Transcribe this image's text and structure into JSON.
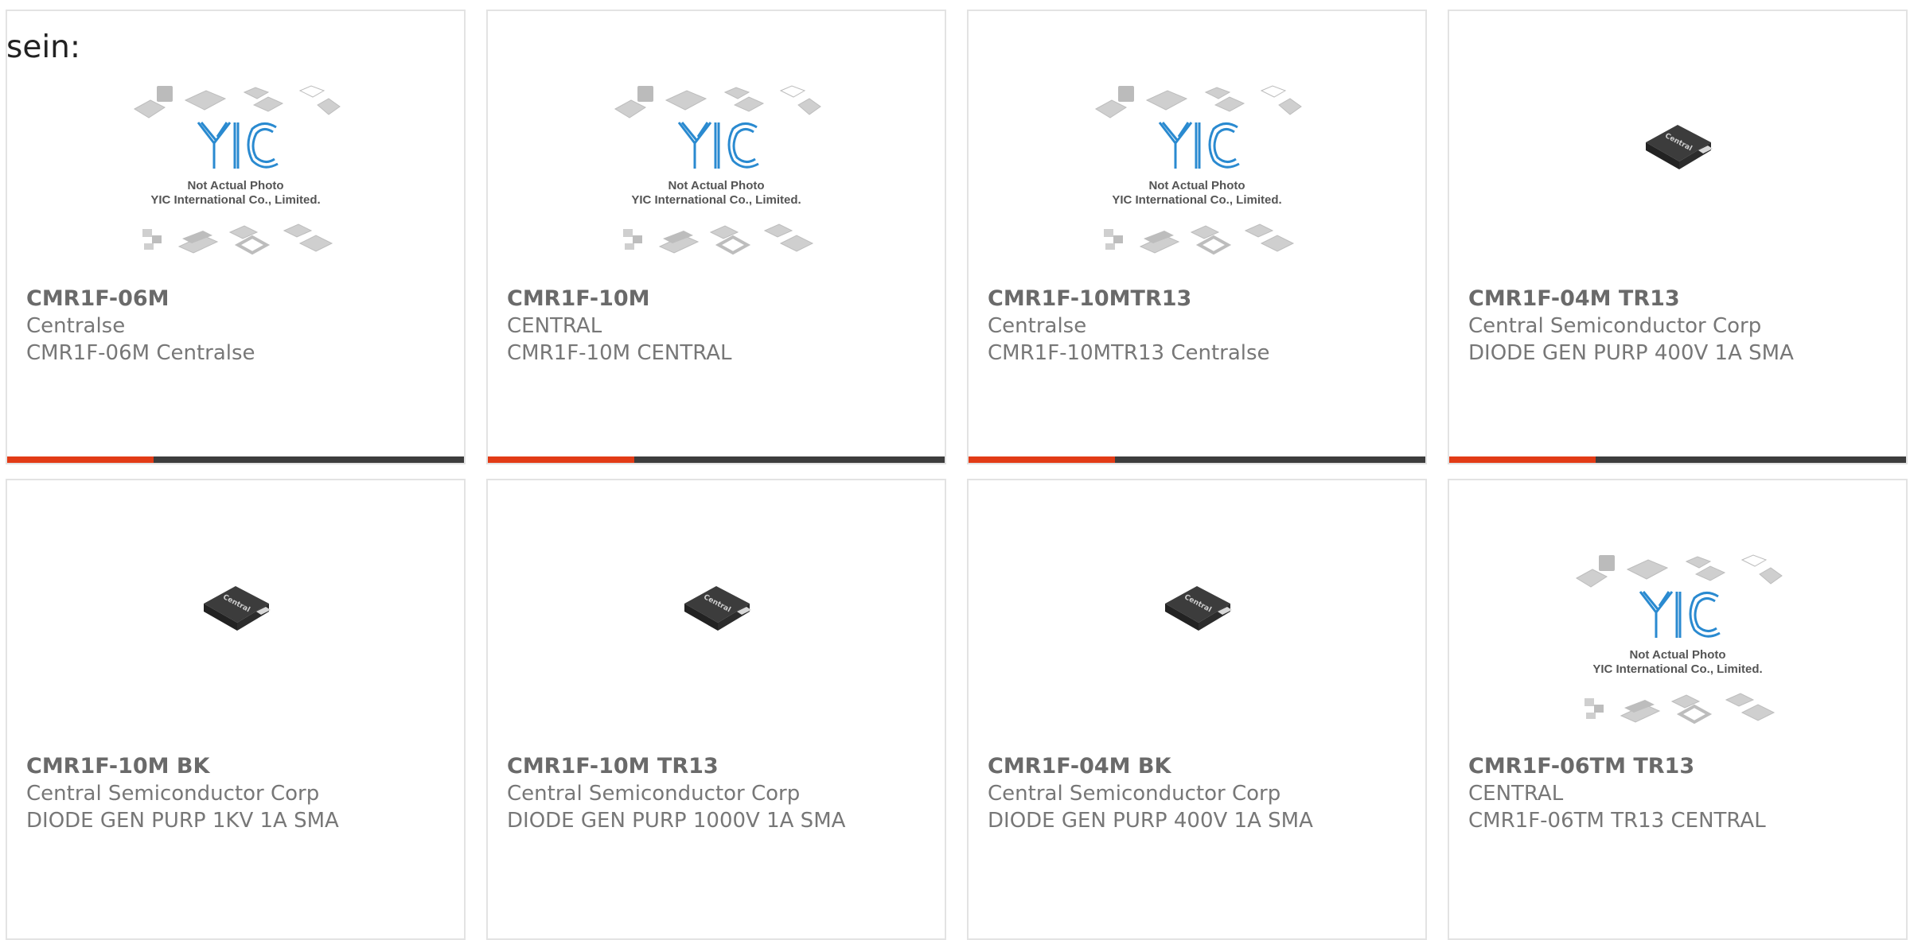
{
  "intro_text": "sein:",
  "colors": {
    "accent": "#e23b16",
    "bar_track": "#3d3d3d",
    "text_muted": "#777777",
    "card_border": "#e3e3e3"
  },
  "placeholder": {
    "line1": "Not Actual Photo",
    "line2": "YIC International Co., Limited.",
    "logo": "YIC"
  },
  "diode_brand": "Central",
  "products": [
    {
      "part": "CMR1F-06M",
      "maker": "Centralse",
      "desc": "CMR1F-06M Centralse",
      "image": "placeholder",
      "progress": 0.32
    },
    {
      "part": "CMR1F-10M",
      "maker": "CENTRAL",
      "desc": "CMR1F-10M CENTRAL",
      "image": "placeholder",
      "progress": 0.32
    },
    {
      "part": "CMR1F-10MTR13",
      "maker": "Centralse",
      "desc": "CMR1F-10MTR13 Centralse",
      "image": "placeholder",
      "progress": 0.32
    },
    {
      "part": "CMR1F-04M TR13",
      "maker": "Central Semiconductor Corp",
      "desc": "DIODE GEN PURP 400V 1A SMA",
      "image": "diode",
      "progress": 0.32
    },
    {
      "part": "CMR1F-10M BK",
      "maker": "Central Semiconductor Corp",
      "desc": "DIODE GEN PURP 1KV 1A SMA",
      "image": "diode"
    },
    {
      "part": "CMR1F-10M TR13",
      "maker": "Central Semiconductor Corp",
      "desc": "DIODE GEN PURP 1000V 1A SMA",
      "image": "diode"
    },
    {
      "part": "CMR1F-04M BK",
      "maker": "Central Semiconductor Corp",
      "desc": "DIODE GEN PURP 400V 1A SMA",
      "image": "diode"
    },
    {
      "part": "CMR1F-06TM TR13",
      "maker": "CENTRAL",
      "desc": "CMR1F-06TM TR13 CENTRAL",
      "image": "placeholder"
    }
  ]
}
